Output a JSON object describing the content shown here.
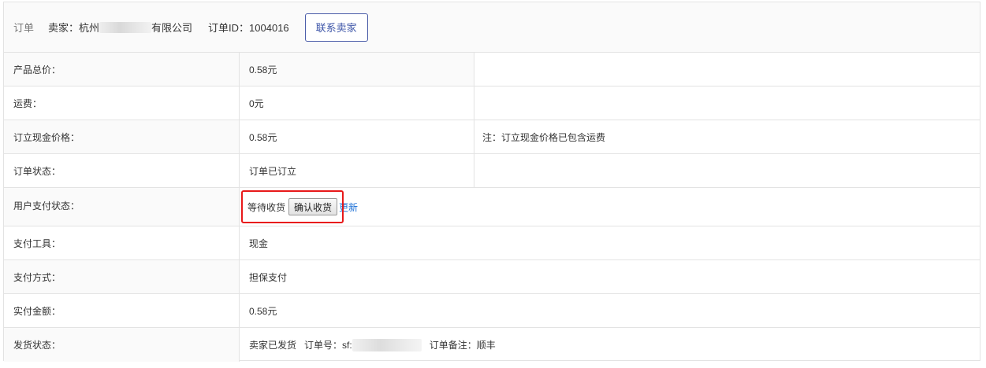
{
  "header": {
    "section_label": "订单",
    "seller_prefix": "卖家：杭州",
    "seller_suffix": "有限公司",
    "order_id": "订单ID：1004016",
    "contact_button": "联系卖家"
  },
  "rows": [
    {
      "label": "产品总价：",
      "value": "0.58元"
    },
    {
      "label": "运费：",
      "value": "0元"
    },
    {
      "label": "订立现金价格：",
      "value": "0.58元",
      "note": "注：订立现金价格已包含运费"
    },
    {
      "label": "订单状态：",
      "value": "订单已订立"
    },
    {
      "label": "用户支付状态：",
      "status_text": "等待收货",
      "confirm_button": "确认收货",
      "update_link": "更新"
    },
    {
      "label": "支付工具：",
      "value": "现金"
    },
    {
      "label": "支付方式：",
      "value": "担保支付"
    },
    {
      "label": "实付金额：",
      "value": "0.58元"
    },
    {
      "label": "发货状态：",
      "shipped_text": "卖家已发货",
      "tracking_prefix": "订单号：sf:",
      "remark": "订单备注：顺丰"
    }
  ],
  "colors": {
    "highlight_border": "#e8191a",
    "link": "#1b6fd6",
    "contact_button_border": "#4a5ca8"
  }
}
